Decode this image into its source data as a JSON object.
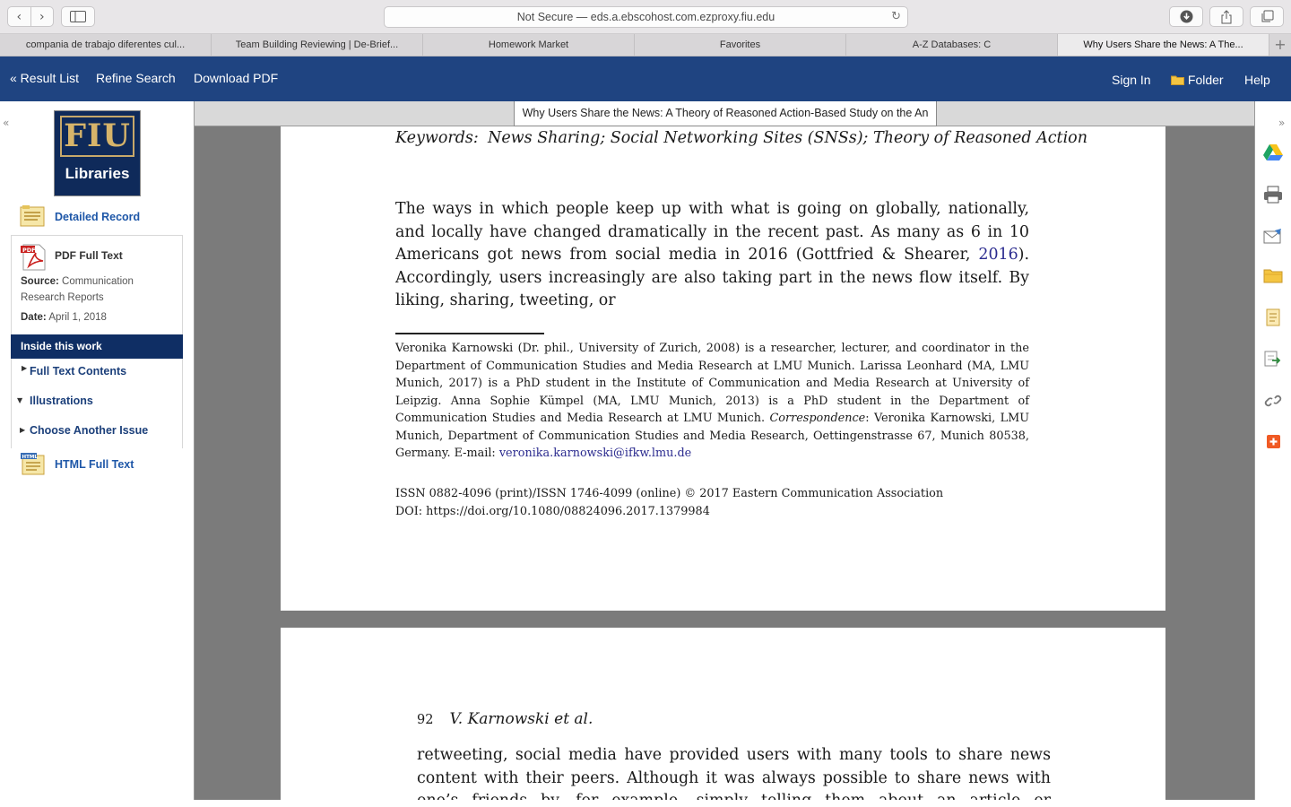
{
  "browser": {
    "address": "Not Secure — eds.a.ebscohost.com.ezproxy.fiu.edu",
    "tabs": [
      {
        "label": "compania de trabajo diferentes cul..."
      },
      {
        "label": "Team Building Reviewing | De-Brief..."
      },
      {
        "label": "Homework Market"
      },
      {
        "label": "Favorites"
      },
      {
        "label": "A-Z Databases: C"
      },
      {
        "label": "Why Users Share the News: A The..."
      }
    ],
    "active_tab": 5,
    "new_tab": "+"
  },
  "ebsco": {
    "result_list": "« Result List",
    "refine_search": "Refine Search",
    "download_pdf": "Download PDF",
    "sign_in": "Sign In",
    "folder": "Folder",
    "help": "Help",
    "accent_color": "#1f4481"
  },
  "sidebar": {
    "logo_fiu": "FIU",
    "logo_libraries": "Libraries",
    "detailed_record": "Detailed Record",
    "pdf_full_text": "PDF Full Text",
    "source_label": "Source:",
    "source_value": "Communication",
    "source_value_2": "Research Reports",
    "date_label": "Date:",
    "date_value": "April 1, 2018",
    "inside_this_work": "Inside this work",
    "full_text_contents": "Full Text Contents",
    "illustrations": "Illustrations",
    "choose_another_issue": "Choose Another Issue",
    "html_full_text": "HTML Full Text",
    "collapse": "«"
  },
  "viewer": {
    "doc_title": "Why Users Share the News: A Theory of Reasoned Action-Based Study on the An",
    "page1": {
      "keywords_label": "Keywords:",
      "keywords": "News Sharing; Social Networking Sites (SNSs); Theory of Reasoned Action",
      "body_a": "The ways in which people keep up with what is going on globally, nationally, and locally have changed dramatically in the recent past. As many as 6 in 10 Americans got news from social media in 2016 (Gottfried & Shearer, ",
      "body_cite": "2016",
      "body_b": "). Accordingly, users increasingly are also taking part in the news flow itself. By liking, sharing, tweeting, or",
      "footnote_a": "Veronika Karnowski (Dr. phil., University of Zurich, 2008) is a researcher, lecturer, and coordinator in the Department of Communication Studies and Media Research at LMU Munich. Larissa Leonhard (MA, LMU Munich, 2017) is a PhD student in the Institute of Communication and Media Research at University of Leipzig. Anna Sophie Kümpel (MA, LMU Munich, 2013) is a PhD student in the Department of Communication Studies and Media Research at LMU Munich. ",
      "footnote_corr": "Correspondence",
      "footnote_b": ": Veronika Karnowski, LMU Munich, Department of Communication Studies and Media Research, Oettingenstrasse 67, Munich 80538, Germany. E-mail: ",
      "footnote_email": "veronika.karnowski@ifkw.lmu.de",
      "issn": "ISSN 0882-4096 (print)/ISSN 1746-4099 (online) © 2017 Eastern Communication Association",
      "doi": "DOI: https://doi.org/10.1080/08824096.2017.1379984"
    },
    "page2": {
      "page_number": "92",
      "running_head": "V. Karnowski et al.",
      "body": "retweeting, social media have provided users with many tools to share news content with their peers. Although it was always possible to share news with one’s friends by, for example, simply telling them about an article or forwarding the copy it appeared in"
    }
  },
  "right_tools": {
    "collapse": "»",
    "icons": [
      "google-drive-icon",
      "print-icon",
      "email-icon",
      "save-folder-icon",
      "cite-icon",
      "export-icon",
      "permalink-icon",
      "share-plus-icon"
    ]
  }
}
